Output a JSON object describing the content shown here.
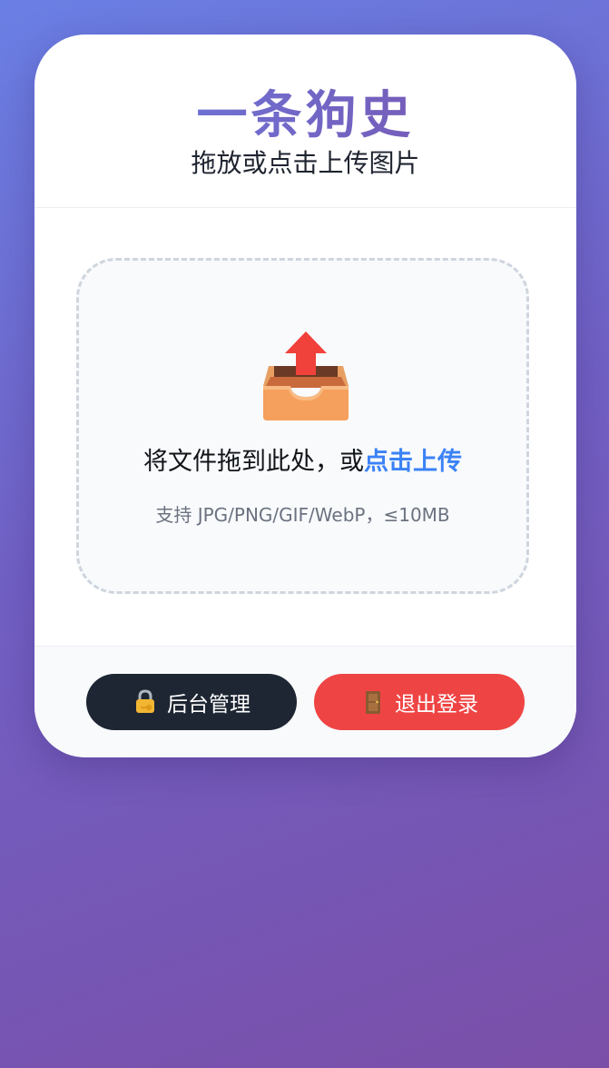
{
  "header": {
    "title": "一条狗史",
    "subtitle": "拖放或点击上传图片"
  },
  "dropzone": {
    "icon": "upload-tray-icon",
    "text_prefix": "将文件拖到此处，或",
    "text_link": "点击上传",
    "hint": "支持 JPG/PNG/GIF/WebP，≤10MB"
  },
  "footer": {
    "admin_button": {
      "icon": "lock-key-icon",
      "label": "后台管理"
    },
    "logout_button": {
      "icon": "door-icon",
      "label": "退出登录"
    }
  },
  "colors": {
    "accent": "#3b82f6",
    "logout": "#ef4444",
    "admin": "#1e2633"
  }
}
